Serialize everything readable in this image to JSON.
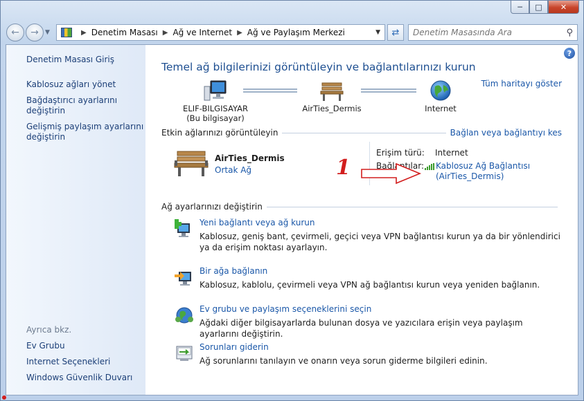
{
  "address": {
    "crumbs": [
      "Denetim Masası",
      "Ağ ve Internet",
      "Ağ ve Paylaşım Merkezi"
    ],
    "search_placeholder": "Denetim Masasında Ara"
  },
  "sidebar": {
    "home": "Denetim Masası Giriş",
    "tasks": [
      "Kablosuz ağları yönet",
      "Bağdaştırıcı ayarlarını değiştirin",
      "Gelişmiş paylaşım ayarlarını değiştirin"
    ],
    "see_also_title": "Ayrıca bkz.",
    "see_also": [
      "Ev Grubu",
      "Internet Seçenekleri",
      "Windows Güvenlik Duvarı"
    ]
  },
  "main": {
    "title": "Temel ağ bilgilerinizi görüntüleyin ve bağlantılarınızı kurun",
    "full_map": "Tüm haritayı göster",
    "map": {
      "computer_name": "ELIF-BILGISAYAR",
      "computer_sub": "(Bu bilgisayar)",
      "network_name": "AirTies_Dermis",
      "internet": "Internet"
    },
    "active_section": {
      "label": "Etkin ağlarınızı görüntüleyin",
      "action": "Bağlan veya bağlantıyı kes"
    },
    "active_network": {
      "name": "AirTies_Dermis",
      "type": "Ortak Ağ",
      "access_label": "Erişim türü:",
      "access_value": "Internet",
      "connections_label": "Bağlantılar:",
      "connection_line1": "Kablosuz Ağ Bağlantısı",
      "connection_line2": "(AirTies_Dermis)"
    },
    "annotation_number": "1",
    "change_section": {
      "label": "Ağ ayarlarınızı değiştirin"
    },
    "tasks": [
      {
        "title": "Yeni bağlantı veya ağ kurun",
        "desc": "Kablosuz, geniş bant, çevirmeli, geçici veya VPN bağlantısı kurun ya da bir yönlendirici ya da erişim noktası ayarlayın."
      },
      {
        "title": "Bir ağa bağlanın",
        "desc": "Kablosuz, kablolu, çevirmeli veya VPN ağ bağlantısı kurun veya yeniden bağlanın."
      },
      {
        "title": "Ev grubu ve paylaşım seçeneklerini seçin",
        "desc": "Ağdaki diğer bilgisayarlarda bulunan dosya ve yazıcılara erişin veya paylaşım ayarlarını değiştirin."
      },
      {
        "title": "Sorunları giderin",
        "desc": "Ağ sorunlarını tanılayın ve onarın veya sorun giderme bilgileri edinin."
      }
    ]
  },
  "colors": {
    "link": "#1a57a8",
    "title": "#1e4f91",
    "annotation": "#d21e1e"
  }
}
